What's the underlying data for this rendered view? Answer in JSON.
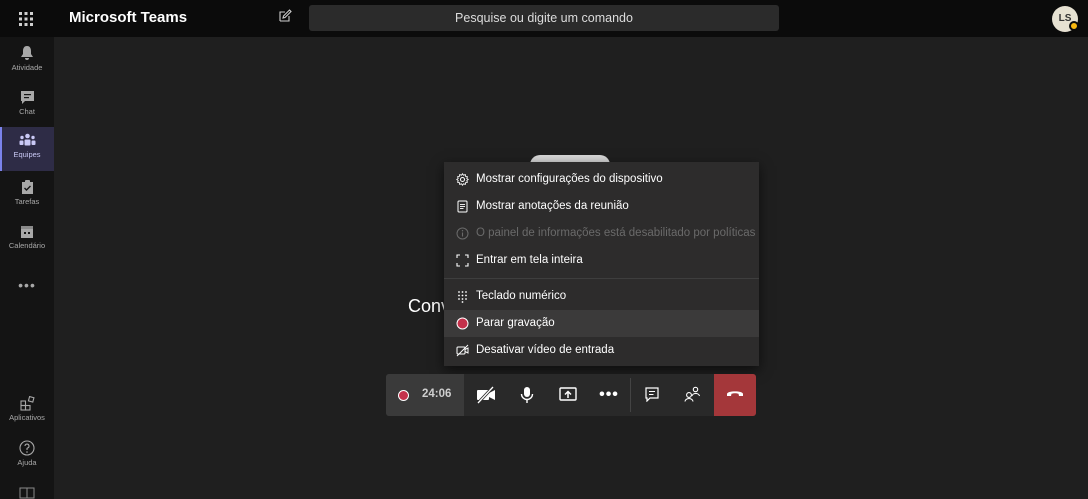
{
  "header": {
    "app_title": "Microsoft Teams",
    "search_placeholder": "Pesquise ou digite um comando",
    "avatar_initials": "LS"
  },
  "rail": {
    "items": [
      {
        "label": "Atividade",
        "icon": "bell-icon"
      },
      {
        "label": "Chat",
        "icon": "chat-icon"
      },
      {
        "label": "Equipes",
        "icon": "teams-icon",
        "active": true
      },
      {
        "label": "Tarefas",
        "icon": "tasks-icon"
      },
      {
        "label": "Calendário",
        "icon": "calendar-icon"
      }
    ],
    "more": "•••",
    "apps_label": "Aplicativos",
    "help_label": "Ajuda"
  },
  "stage": {
    "partial_text": "Conv"
  },
  "menu": {
    "items": [
      {
        "label": "Mostrar configurações do dispositivo",
        "icon": "gear-icon"
      },
      {
        "label": "Mostrar anotações da reunião",
        "icon": "notes-icon"
      },
      {
        "label": "O painel de informações está desabilitado por políticas",
        "icon": "info-icon",
        "disabled": true
      },
      {
        "label": "Entrar em tela inteira",
        "icon": "fullscreen-icon"
      },
      {
        "label": "Teclado numérico",
        "icon": "dialpad-icon"
      },
      {
        "label": "Parar gravação",
        "icon": "record-icon",
        "highlighted": true
      },
      {
        "label": "Desativar vídeo de entrada",
        "icon": "video-off-icon"
      }
    ]
  },
  "callbar": {
    "recording_time": "24:06",
    "more": "•••"
  },
  "colors": {
    "accent": "#7b83eb",
    "record": "#c4314b",
    "hangup": "#a4373a"
  }
}
